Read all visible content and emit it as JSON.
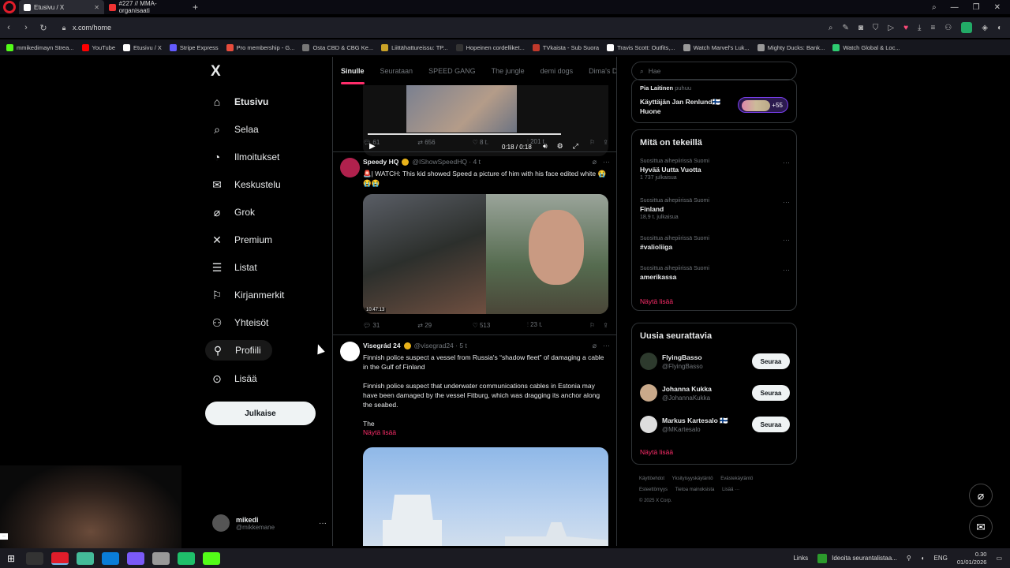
{
  "browser": {
    "tabs": [
      {
        "title": "Etusivu / X",
        "active": true
      },
      {
        "title": "#227 // MMA-organisaati",
        "active": false
      }
    ],
    "url": "x.com/home",
    "bookmarks": [
      "mmikedimayn Strea...",
      "YouTube",
      "Etusivu / X",
      "Stripe Express",
      "Pro membership - G...",
      "Osta CBD & CBG Ke...",
      "Liittähattureissu: TP...",
      "Hopeinen cordelliket...",
      "TVkaista - Sub Suora",
      "Travis Scott: Outfits,...",
      "Watch Marvel's Luk...",
      "Mighty Ducks: Bank...",
      "Watch Global & Loc..."
    ]
  },
  "sidebar": {
    "logo": "X",
    "items": [
      {
        "label": "Etusivu",
        "icon": "home-icon"
      },
      {
        "label": "Selaa",
        "icon": "search-icon"
      },
      {
        "label": "Ilmoitukset",
        "icon": "bell-icon"
      },
      {
        "label": "Keskustelu",
        "icon": "envelope-icon"
      },
      {
        "label": "Grok",
        "icon": "grok-icon"
      },
      {
        "label": "Premium",
        "icon": "x-icon"
      },
      {
        "label": "Listat",
        "icon": "list-icon"
      },
      {
        "label": "Kirjanmerkit",
        "icon": "bookmark-icon"
      },
      {
        "label": "Yhteisöt",
        "icon": "people-icon"
      },
      {
        "label": "Profiili",
        "icon": "person-icon"
      },
      {
        "label": "Lisää",
        "icon": "more-circle-icon"
      }
    ],
    "post_button": "Julkaise",
    "account": {
      "name": "mikedi",
      "handle": "@mikkemane"
    }
  },
  "timeline": {
    "tabs": [
      "Sinulle",
      "Seurataan",
      "SPEED GANG",
      "The jungle",
      "demi dogs",
      "Dima's Di"
    ],
    "video_time": "0:18 / 0:18",
    "first_post_stats": {
      "replies": "61",
      "reposts": "656",
      "likes": "8 t.",
      "views": "201 t."
    },
    "posts": [
      {
        "name": "Speedy HQ",
        "handle": "@IShowSpeedHQ · 4 t",
        "text": "🚨| WATCH: This kid showed Speed a picture of him with his face edited white 😭😭😭",
        "media_timestamp": "10:47:13",
        "stats": {
          "replies": "31",
          "reposts": "29",
          "likes": "513",
          "views": "23 t."
        }
      },
      {
        "name": "Visegrád 24",
        "handle": "@visegrad24 · 5 t",
        "text_lines": [
          "Finnish police suspect a vessel from Russia's “shadow fleet” of damaging a cable in the Gulf of Finland",
          "Finnish police suspect that underwater communications cables in Estonia may have been damaged by the vessel Fitburg, which was dragging its anchor along the seabed.",
          "The"
        ],
        "show_more": "Näytä lisää"
      }
    ]
  },
  "right": {
    "search_placeholder": "Hae",
    "space": {
      "host": "Pia Laitinen",
      "status": "puhuu",
      "title": "Käyttäjän Jan Renlund🇫🇮 Huone",
      "count": "+55"
    },
    "trends_title": "Mitä on tekeillä",
    "trends": [
      {
        "context": "Suosittua aihepiirissä Suomi",
        "topic": "Hyvää Uutta Vuotta",
        "count": "1 737 julkaisua"
      },
      {
        "context": "Suosittua aihepiirissä Suomi",
        "topic": "Finland",
        "count": "18,9 t. julkaisua"
      },
      {
        "context": "Suosittua aihepiirissä Suomi",
        "topic": "#valioliiga",
        "count": ""
      },
      {
        "context": "Suosittua aihepiirissä Suomi",
        "topic": "amerikassa",
        "count": ""
      }
    ],
    "show_more": "Näytä lisää",
    "follow_title": "Uusia seurattavia",
    "follow": [
      {
        "name": "FlyingBasso",
        "handle": "@FlyingBasso",
        "button": "Seuraa"
      },
      {
        "name": "Johanna Kukka",
        "handle": "@JohannaKukka",
        "button": "Seuraa"
      },
      {
        "name": "Markus Kartesalo 🇫🇮",
        "handle": "@MKartesalo",
        "button": "Seuraa"
      }
    ],
    "footer": [
      "Käyttöehdot",
      "Yksityisyyskäytäntö",
      "Evästekäytäntö",
      "Esteettömyys",
      "Tietoa mainoksista",
      "Lisää ···",
      "© 2025 X Corp."
    ]
  },
  "taskbar": {
    "links_label": "Links",
    "news_text": "Ideoita seurantalistaa...",
    "lang": "ENG",
    "time": "0.30",
    "date": "01/01/2026"
  },
  "colors": {
    "accent": "#ff2d6b",
    "verified_gold": "#e8b21a",
    "verified_blue": "#1d9bf0"
  }
}
